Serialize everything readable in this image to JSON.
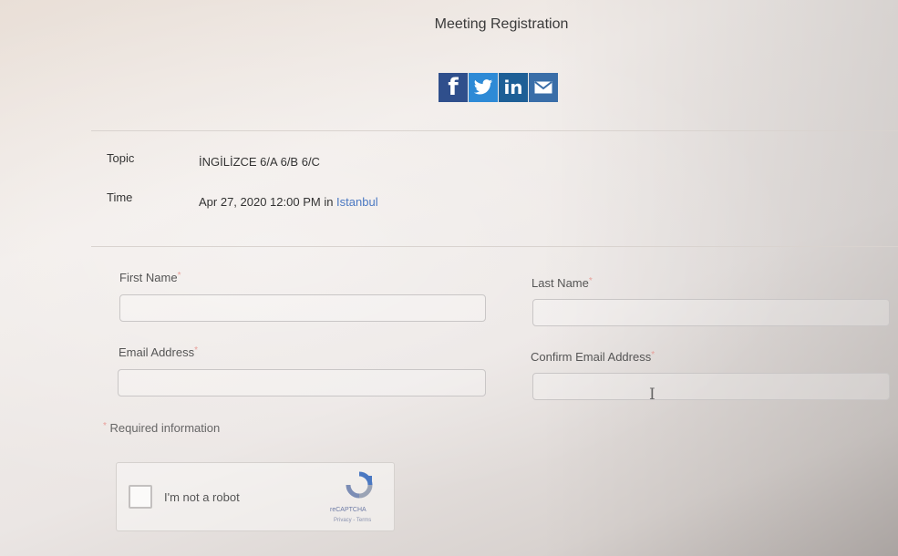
{
  "page": {
    "title": "Meeting Registration"
  },
  "share": {
    "buttons": [
      {
        "icon": "facebook-icon",
        "glyph": "f",
        "color": "#2f4f8c"
      },
      {
        "icon": "twitter-icon",
        "glyph": "",
        "color": "#2e8ad6"
      },
      {
        "icon": "linkedin-icon",
        "glyph": "in",
        "color": "#1e5f96"
      },
      {
        "icon": "email-icon",
        "glyph": "",
        "color": "#3a6ea8"
      }
    ]
  },
  "meeting": {
    "topic_label": "Topic",
    "topic_value": "İNGİLİZCE 6/A 6/B 6/C",
    "time_label": "Time",
    "time_value": "Apr 27, 2020 12:00 PM in ",
    "timezone_link": "Istanbul"
  },
  "form": {
    "first_name_label": "First Name",
    "last_name_label": "Last Name",
    "email_label": "Email Address",
    "confirm_email_label": "Confirm Email Address",
    "required_mark": "*",
    "first_name_value": "",
    "last_name_value": "",
    "email_value": "",
    "confirm_email_value": "",
    "required_info": "Required information"
  },
  "captcha": {
    "checkbox_label": "I'm not a robot",
    "brand": "reCAPTCHA",
    "terms": "Privacy - Terms"
  },
  "colors": {
    "link": "#4a78c2",
    "required": "#e8a09a"
  }
}
